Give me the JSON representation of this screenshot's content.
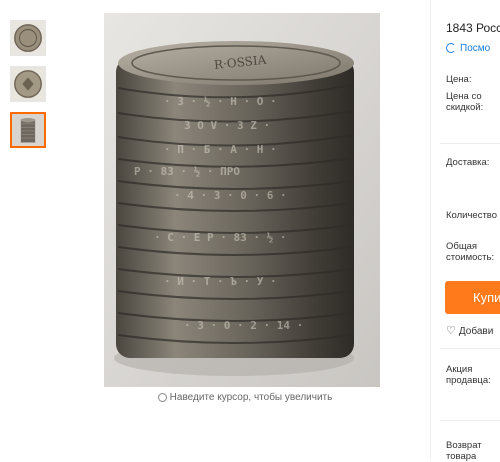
{
  "product": {
    "title": "1843 Росс",
    "recently_viewed": "Посмо"
  },
  "gallery": {
    "thumbnails": [
      {
        "name": "coin-obverse",
        "active": false
      },
      {
        "name": "coin-reverse",
        "active": false
      },
      {
        "name": "coin-stack",
        "active": true
      }
    ],
    "zoom_hint": "Наведите курсор, чтобы увеличить"
  },
  "details": {
    "price_label": "Цена:",
    "discount_price_label": "Цена со\nскидкой:",
    "delivery_label": "Доставка:",
    "quantity_label": "Количество",
    "total_label": "Общая\nстоимость:",
    "seller_promo_label": "Акция\nпродавца:",
    "returns_label": "Возврат\nтовара"
  },
  "actions": {
    "buy_label": "Купи",
    "wishlist_label": "Добави"
  },
  "colors": {
    "accent": "#ff7a1a",
    "link": "#1a7fe0"
  }
}
